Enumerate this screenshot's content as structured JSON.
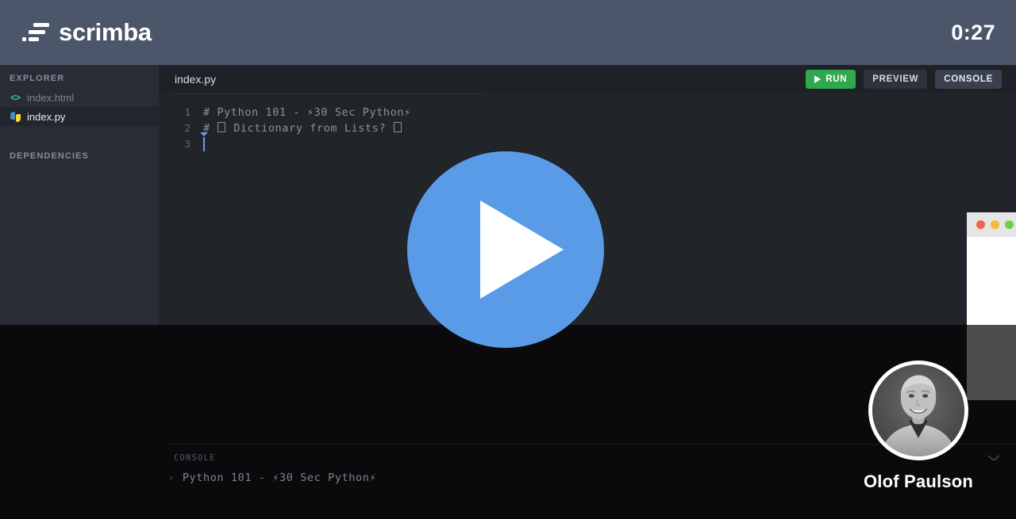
{
  "header": {
    "brand_name": "scrimba",
    "logo_icon": "scrimba-logo-icon",
    "timer": "0:27"
  },
  "sidebar": {
    "explorer_title": "EXPLORER",
    "dependencies_title": "DEPENDENCIES",
    "files": [
      {
        "name": "index.html",
        "icon": "html-code-icon",
        "active": false
      },
      {
        "name": "index.py",
        "icon": "python-icon",
        "active": true
      }
    ]
  },
  "editor": {
    "tab_label": "index.py",
    "lines": [
      {
        "number": "1",
        "pre": "# Python 101 - ⚡30 Sec Python⚡"
      },
      {
        "number": "2",
        "pre_a": "# ",
        "pre_b": " Dictionary from Lists? ",
        "pre_c": ""
      },
      {
        "number": "3",
        "pre": ""
      }
    ],
    "line1_text": "# Python 101 - ⚡30 Sec Python⚡",
    "line2_before": "# ",
    "line2_middle": " Dictionary from Lists? ",
    "line3_text": ""
  },
  "toolbar": {
    "run_label": "RUN",
    "run_icon": "play-icon",
    "preview_label": "PREVIEW",
    "console_label": "CONSOLE"
  },
  "console": {
    "label": "CONSOLE",
    "prompt": "›",
    "output_text": "Python 101 - ⚡30 Sec Python⚡",
    "collapse_icon": "chevron-down-icon"
  },
  "overlay": {
    "play_icon": "play-icon"
  },
  "cast_window": {
    "traffic_lights": [
      "close",
      "minimize",
      "maximize"
    ]
  },
  "presenter": {
    "name": "Olof Paulson",
    "avatar_icon": "presenter-avatar"
  },
  "colors": {
    "header_bg": "#4c566b",
    "sidebar_bg": "#282c35",
    "editor_bg": "#212429",
    "lower_bg": "#0a0a0c",
    "run_green": "#2fa84f",
    "play_blue": "#5a9be8",
    "caret_blue": "#6a9cea"
  }
}
